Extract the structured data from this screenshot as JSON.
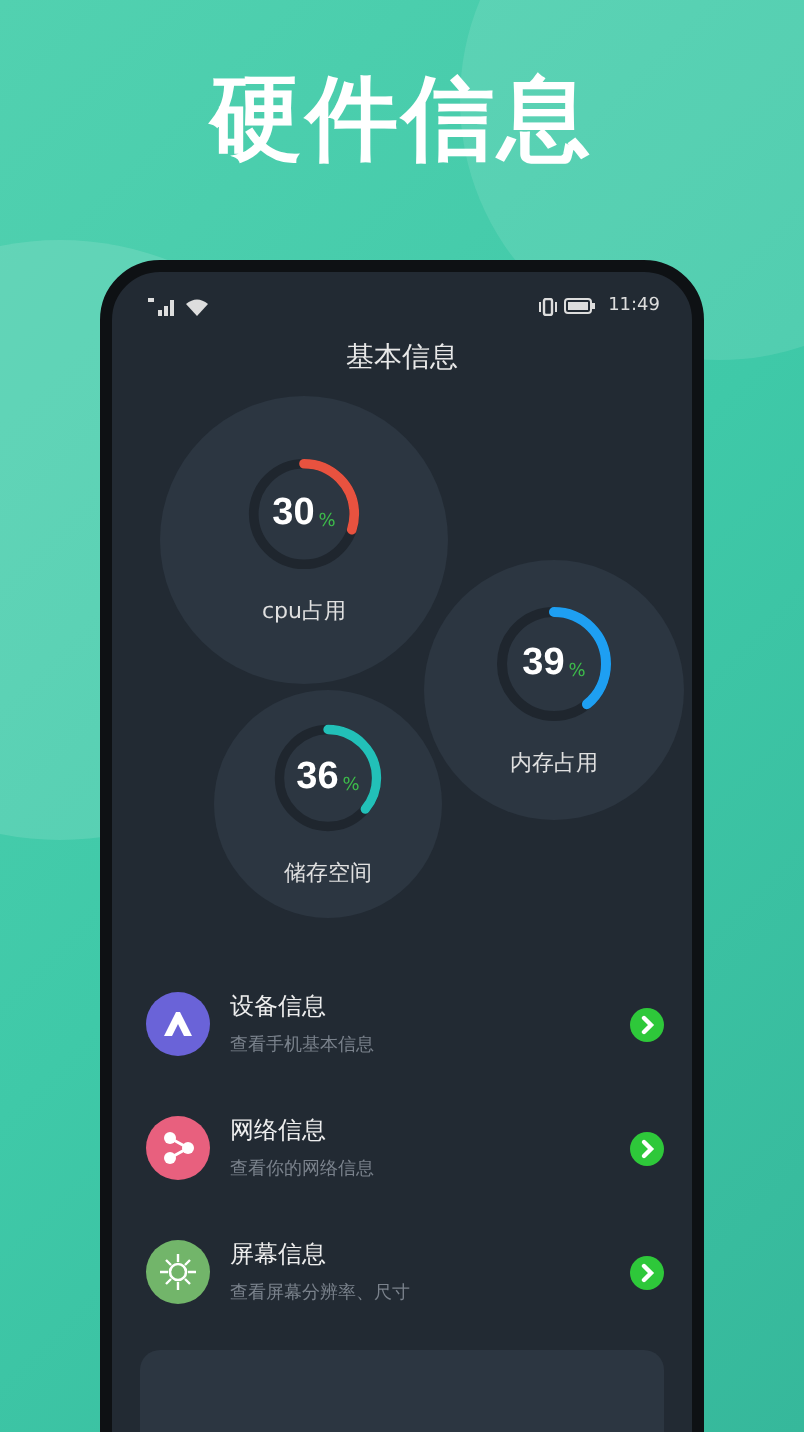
{
  "headline": "硬件信息",
  "status_bar": {
    "time": "11:49"
  },
  "screen_title": "基本信息",
  "gauges": [
    {
      "value": "30",
      "unit": "%",
      "label": "cpu占用",
      "level": 0.3,
      "color": "#e8523f"
    },
    {
      "value": "39",
      "unit": "%",
      "label": "内存占用",
      "level": 0.39,
      "color": "#1e9ff2"
    },
    {
      "value": "36",
      "unit": "%",
      "label": "储存空间",
      "level": 0.36,
      "color": "#22c0b8"
    }
  ],
  "items": [
    {
      "kind": "device",
      "title": "设备信息",
      "subtitle": "查看手机基本信息",
      "color": "#6a63d8"
    },
    {
      "kind": "network",
      "title": "网络信息",
      "subtitle": "查看你的网络信息",
      "color": "#e8607e"
    },
    {
      "kind": "screen",
      "title": "屏幕信息",
      "subtitle": "查看屏幕分辨率、尺寸",
      "color": "#72b56a"
    }
  ]
}
